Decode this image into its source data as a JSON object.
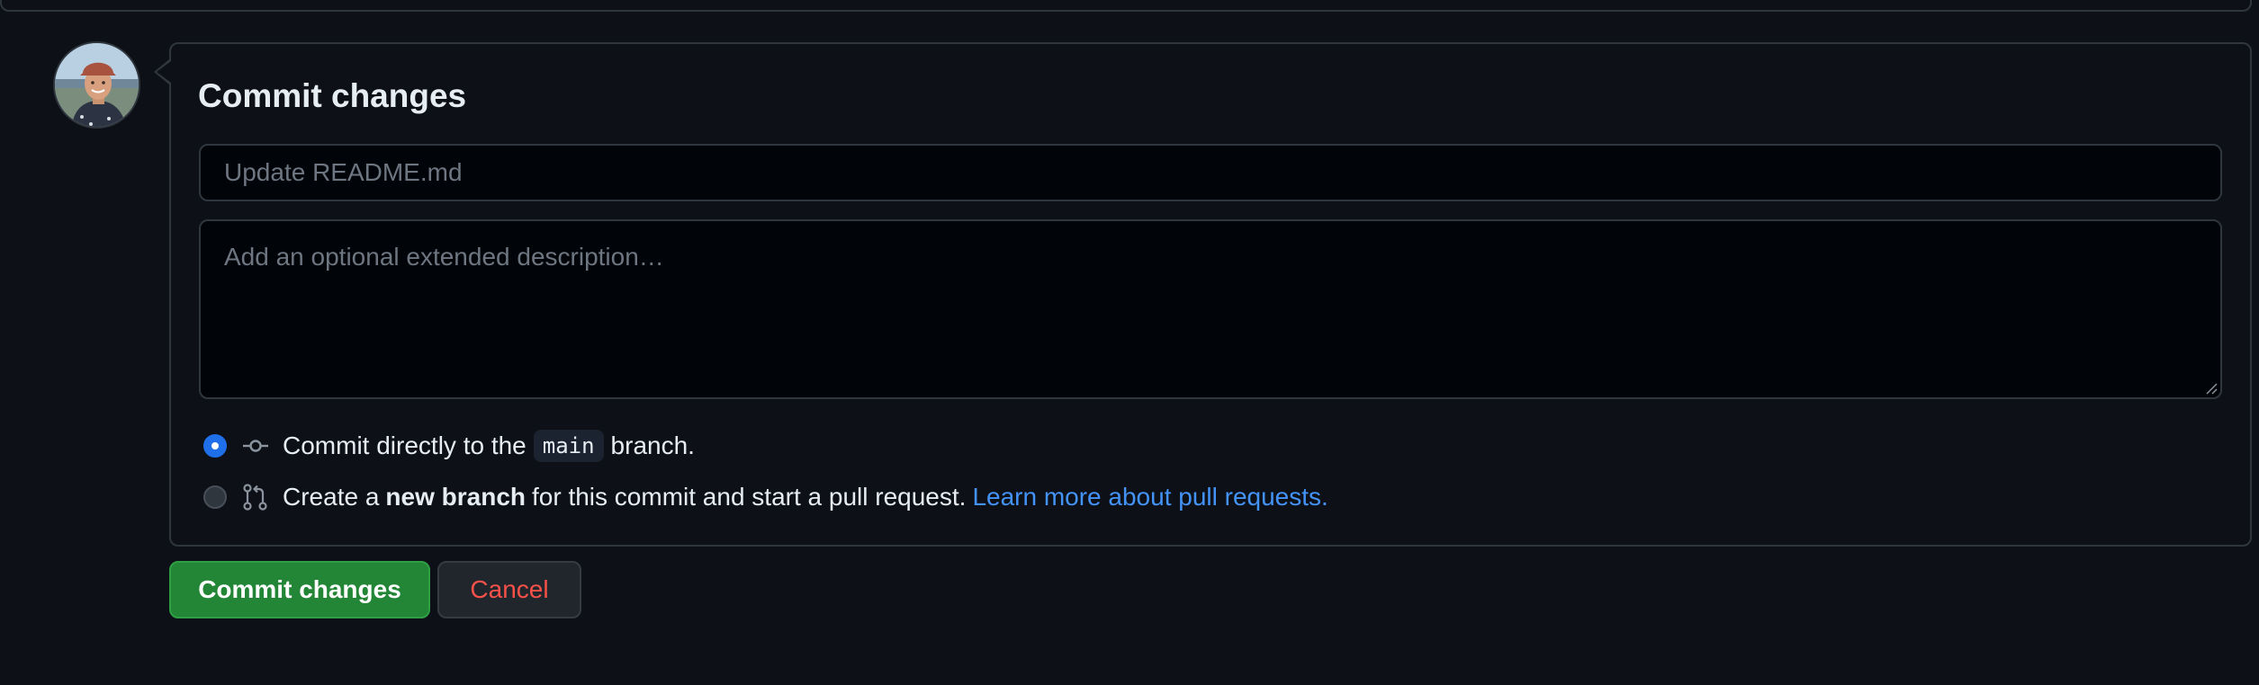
{
  "form": {
    "title": "Commit changes",
    "summary_placeholder": "Update README.md",
    "summary_value": "",
    "description_placeholder": "Add an optional extended description…",
    "description_value": ""
  },
  "options": {
    "direct": {
      "selected": true,
      "prefix": "Commit directly to the",
      "branch": "main",
      "suffix": "branch.",
      "icon": "git-commit-icon"
    },
    "new_branch": {
      "selected": false,
      "prefix": "Create a",
      "bold": "new branch",
      "suffix": "for this commit and start a pull request.",
      "link": "Learn more about pull requests.",
      "icon": "git-pull-request-icon"
    }
  },
  "buttons": {
    "commit_label": "Commit changes",
    "cancel_label": "Cancel"
  },
  "colors": {
    "background": "#0d1117",
    "primary_button": "#238636",
    "cancel_text": "#f85149",
    "link": "#4493f8",
    "radio_selected": "#1f6feb"
  }
}
